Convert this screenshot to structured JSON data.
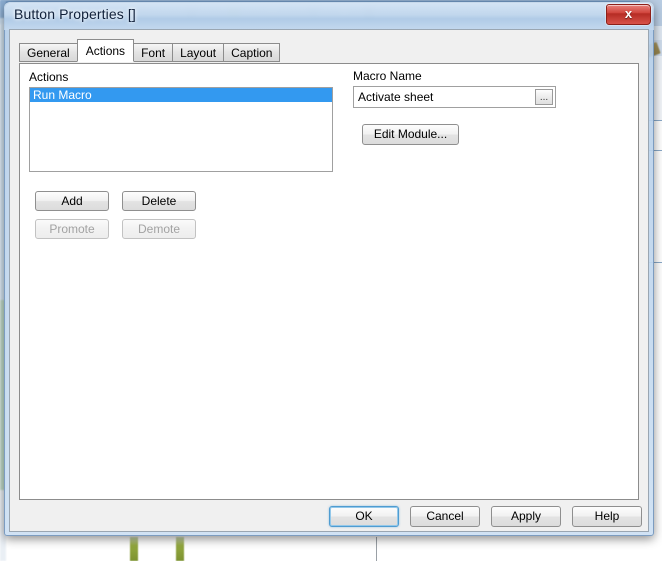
{
  "window": {
    "title": "Button Properties []",
    "close_icon": "close-x-icon",
    "close_label": "x"
  },
  "tabs": [
    {
      "label": "General",
      "active": false
    },
    {
      "label": "Actions",
      "active": true
    },
    {
      "label": "Font",
      "active": false
    },
    {
      "label": "Layout",
      "active": false
    },
    {
      "label": "Caption",
      "active": false
    }
  ],
  "actions_panel": {
    "list_label": "Actions",
    "items": [
      {
        "label": "Run Macro",
        "selected": true
      }
    ],
    "buttons": {
      "add": {
        "label": "Add",
        "enabled": true
      },
      "delete": {
        "label": "Delete",
        "enabled": true
      },
      "promote": {
        "label": "Promote",
        "enabled": false
      },
      "demote": {
        "label": "Demote",
        "enabled": false
      }
    }
  },
  "macro_panel": {
    "name_label": "Macro Name",
    "name_value": "Activate sheet",
    "name_placeholder": "",
    "browse_label": "...",
    "edit_module_label": "Edit Module..."
  },
  "dialog_buttons": {
    "ok": "OK",
    "cancel": "Cancel",
    "apply": "Apply",
    "help": "Help"
  },
  "colors": {
    "selection_blue": "#3399f0",
    "close_red": "#c9382f",
    "dialog_face": "#f0f0f0",
    "panel_white": "#ffffff",
    "default_focus": "#4f9cd1"
  }
}
